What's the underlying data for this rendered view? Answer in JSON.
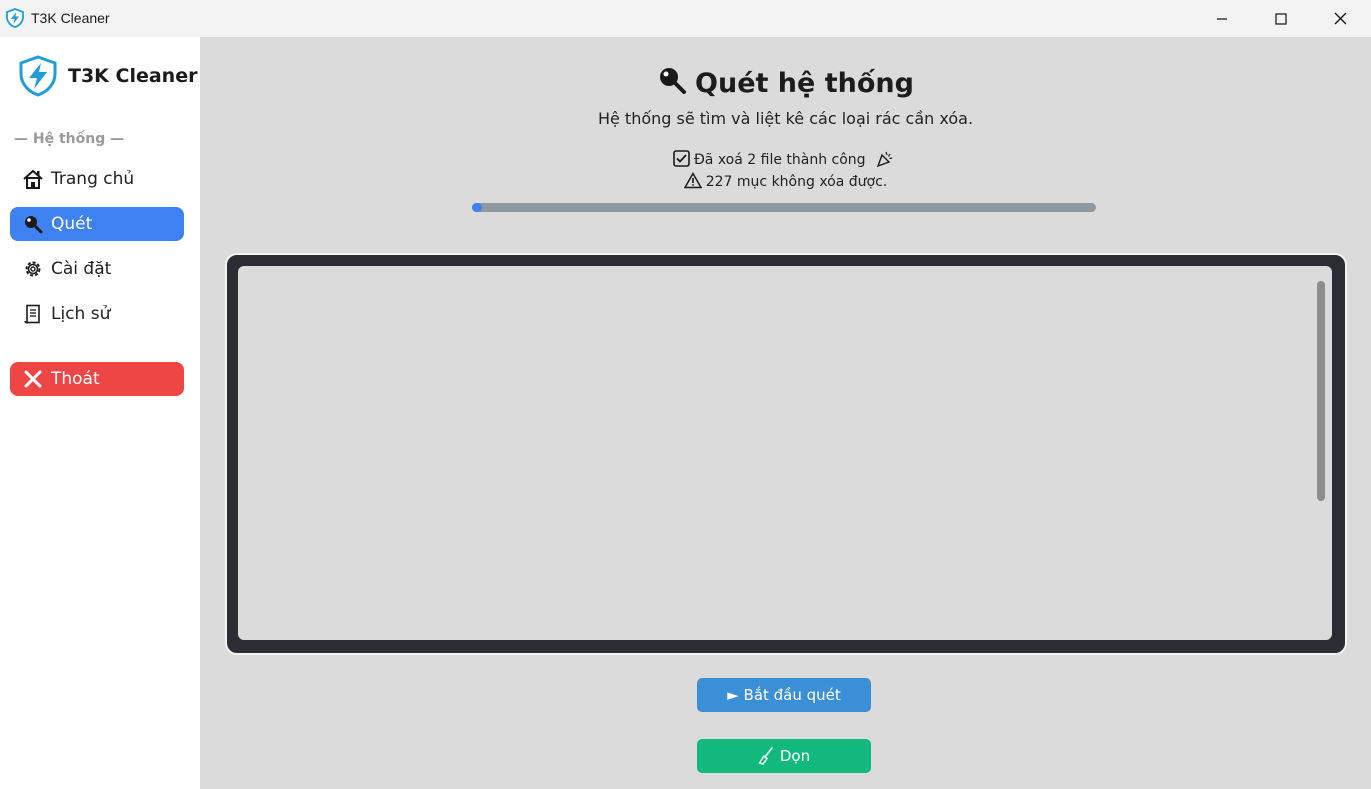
{
  "window": {
    "title": "T3K Cleaner",
    "controls": [
      "minimize-icon",
      "maximize-icon",
      "close-icon"
    ]
  },
  "sidebar": {
    "brand": "T3K Cleaner",
    "section_label": "— Hệ thống —",
    "items": [
      {
        "label": "Trang chủ",
        "icon": "house-icon",
        "active": false
      },
      {
        "label": "Quét",
        "icon": "magnifier-icon",
        "active": true
      },
      {
        "label": "Cài đặt",
        "icon": "gear-icon",
        "active": false
      },
      {
        "label": "Lịch sử",
        "icon": "scroll-icon",
        "active": false
      }
    ],
    "exit": {
      "label": "Thoát",
      "icon": "close-x-icon"
    }
  },
  "main": {
    "title": "Quét hệ thống",
    "title_icon": "magnifier-icon",
    "subtitle": "Hệ thống sẽ tìm và liệt kê các loại rác cần xóa.",
    "status_success": "Đã xoá 2 file thành công",
    "status_warning": "227 mục không xóa được.",
    "progress_fraction": 0.01,
    "scan_button": "► Bắt đầu quét",
    "clean_button": "Dọn"
  },
  "colors": {
    "accent": "#3d82f0",
    "danger": "#ee4545",
    "scan": "#3b8fd6",
    "clean": "#11b97d",
    "background": "#dbdbdb",
    "sidebar": "#ffffff"
  }
}
